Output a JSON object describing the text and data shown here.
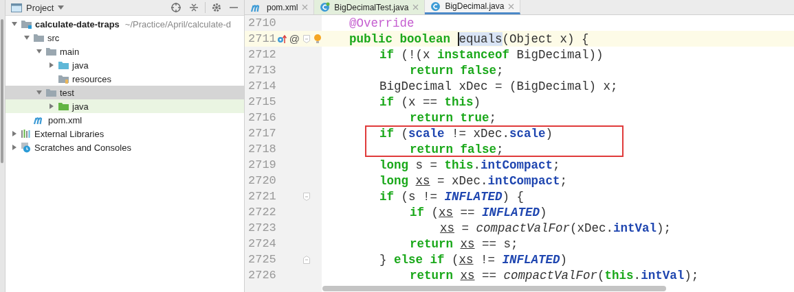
{
  "project_panel": {
    "title": "Project",
    "tree": [
      {
        "label": "calculate-date-traps",
        "path": "~/Practice/April/calculate-d",
        "kind": "module",
        "expanded": true,
        "selected": false,
        "highlighted": false,
        "children": [
          {
            "label": "src",
            "kind": "folder",
            "expanded": true,
            "selected": false,
            "highlighted": false,
            "children": [
              {
                "label": "main",
                "kind": "folder",
                "expanded": true,
                "selected": false,
                "highlighted": false,
                "children": [
                  {
                    "label": "java",
                    "kind": "source",
                    "expanded": false,
                    "selected": false,
                    "highlighted": false
                  },
                  {
                    "label": "resources",
                    "kind": "resources",
                    "selected": false,
                    "highlighted": false
                  }
                ]
              },
              {
                "label": "test",
                "kind": "folder",
                "expanded": true,
                "selected": true,
                "highlighted": false,
                "children": [
                  {
                    "label": "java",
                    "kind": "test-source",
                    "expanded": false,
                    "selected": false,
                    "highlighted": true
                  }
                ]
              }
            ]
          },
          {
            "label": "pom.xml",
            "kind": "maven",
            "selected": false,
            "highlighted": false
          }
        ]
      },
      {
        "label": "External Libraries",
        "kind": "libraries",
        "expanded": false,
        "selected": false,
        "highlighted": false
      },
      {
        "label": "Scratches and Consoles",
        "kind": "scratches",
        "expanded": false,
        "selected": false,
        "highlighted": false
      }
    ]
  },
  "tabs": [
    {
      "label": "pom.xml",
      "kind": "maven",
      "selected": false
    },
    {
      "label": "BigDecimalTest.java",
      "kind": "test-class",
      "selected": false
    },
    {
      "label": "BigDecimal.java",
      "kind": "class",
      "selected": true
    }
  ],
  "editor": {
    "lines": [
      {
        "number": "2710",
        "current": false,
        "boxed": false,
        "tokens": [
          {
            "text": "@Override",
            "kind": "ann"
          }
        ]
      },
      {
        "number": "2711",
        "current": true,
        "boxed": false,
        "override_marker": true,
        "annotation_marker": "@",
        "fold_start": true,
        "intention": true,
        "tokens": [
          {
            "text": "public boolean ",
            "kind": "kw"
          },
          {
            "text": "equals",
            "kind": "sel"
          },
          {
            "text": "(Object x) {",
            "kind": "plain"
          }
        ],
        "children": [
          {
            "number": "2712",
            "current": false,
            "boxed": false,
            "tokens": [
              {
                "text": "if ",
                "kind": "kw"
              },
              {
                "text": "(!(x ",
                "kind": "plain"
              },
              {
                "text": "instanceof",
                "kind": "kw"
              },
              {
                "text": " BigDecimal))",
                "kind": "plain"
              }
            ],
            "children": [
              {
                "number": "2713",
                "current": false,
                "boxed": false,
                "tokens": [
                  {
                    "text": "return false",
                    "kind": "kw"
                  },
                  {
                    "text": ";",
                    "kind": "plain"
                  }
                ]
              }
            ]
          },
          {
            "number": "2714",
            "current": false,
            "boxed": false,
            "tokens": [
              {
                "text": "BigDecimal xDec = (BigDecimal) x;",
                "kind": "plain"
              }
            ]
          },
          {
            "number": "2715",
            "current": false,
            "boxed": false,
            "tokens": [
              {
                "text": "if ",
                "kind": "kw"
              },
              {
                "text": "(x == ",
                "kind": "plain"
              },
              {
                "text": "this",
                "kind": "kw"
              },
              {
                "text": ")",
                "kind": "plain"
              }
            ],
            "children": [
              {
                "number": "2716",
                "current": false,
                "boxed": false,
                "tokens": [
                  {
                    "text": "return true",
                    "kind": "kw"
                  },
                  {
                    "text": ";",
                    "kind": "plain"
                  }
                ]
              }
            ]
          },
          {
            "number": "2717",
            "current": false,
            "boxed": true,
            "tokens": [
              {
                "text": "if ",
                "kind": "kw"
              },
              {
                "text": "(",
                "kind": "plain"
              },
              {
                "text": "scale",
                "kind": "field"
              },
              {
                "text": " != xDec.",
                "kind": "plain"
              },
              {
                "text": "scale",
                "kind": "field"
              },
              {
                "text": ")",
                "kind": "plain"
              }
            ],
            "children": [
              {
                "number": "2718",
                "current": false,
                "boxed": true,
                "tokens": [
                  {
                    "text": "return false",
                    "kind": "kw"
                  },
                  {
                    "text": ";",
                    "kind": "plain"
                  }
                ]
              }
            ]
          },
          {
            "number": "2719",
            "current": false,
            "boxed": false,
            "tokens": [
              {
                "text": "long ",
                "kind": "kw"
              },
              {
                "text": "s = ",
                "kind": "plain"
              },
              {
                "text": "this",
                "kind": "kw"
              },
              {
                "text": ".",
                "kind": "plain"
              },
              {
                "text": "intCompact",
                "kind": "field"
              },
              {
                "text": ";",
                "kind": "plain"
              }
            ]
          },
          {
            "number": "2720",
            "current": false,
            "boxed": false,
            "tokens": [
              {
                "text": "long ",
                "kind": "kw"
              },
              {
                "text": "xs",
                "kind": "var"
              },
              {
                "text": " = xDec.",
                "kind": "plain"
              },
              {
                "text": "intCompact",
                "kind": "field"
              },
              {
                "text": ";",
                "kind": "plain"
              }
            ]
          },
          {
            "number": "2721",
            "current": false,
            "boxed": false,
            "fold_start": true,
            "tokens": [
              {
                "text": "if ",
                "kind": "kw"
              },
              {
                "text": "(s != ",
                "kind": "plain"
              },
              {
                "text": "INFLATED",
                "kind": "const"
              },
              {
                "text": ") {",
                "kind": "plain"
              }
            ],
            "children": [
              {
                "number": "2722",
                "current": false,
                "boxed": false,
                "tokens": [
                  {
                    "text": "if ",
                    "kind": "kw"
                  },
                  {
                    "text": "(",
                    "kind": "plain"
                  },
                  {
                    "text": "xs",
                    "kind": "var"
                  },
                  {
                    "text": " == ",
                    "kind": "plain"
                  },
                  {
                    "text": "INFLATED",
                    "kind": "const"
                  },
                  {
                    "text": ")",
                    "kind": "plain"
                  }
                ],
                "children": [
                  {
                    "number": "2723",
                    "current": false,
                    "boxed": false,
                    "tokens": [
                      {
                        "text": "xs",
                        "kind": "var"
                      },
                      {
                        "text": " = ",
                        "kind": "plain"
                      },
                      {
                        "text": "compactValFor",
                        "kind": "call"
                      },
                      {
                        "text": "(xDec.",
                        "kind": "plain"
                      },
                      {
                        "text": "intVal",
                        "kind": "field"
                      },
                      {
                        "text": ");",
                        "kind": "plain"
                      }
                    ]
                  }
                ]
              },
              {
                "number": "2724",
                "current": false,
                "boxed": false,
                "tokens": [
                  {
                    "text": "return ",
                    "kind": "kw"
                  },
                  {
                    "text": "xs",
                    "kind": "var"
                  },
                  {
                    "text": " == s;",
                    "kind": "plain"
                  }
                ]
              }
            ]
          },
          {
            "number": "2725",
            "current": false,
            "boxed": false,
            "fold_end": true,
            "tokens": [
              {
                "text": "} ",
                "kind": "plain"
              },
              {
                "text": "else if ",
                "kind": "kw"
              },
              {
                "text": "(",
                "kind": "plain"
              },
              {
                "text": "xs",
                "kind": "var"
              },
              {
                "text": " != ",
                "kind": "plain"
              },
              {
                "text": "INFLATED",
                "kind": "const"
              },
              {
                "text": ")",
                "kind": "plain"
              }
            ],
            "children": [
              {
                "number": "2726",
                "current": false,
                "boxed": false,
                "tokens": [
                  {
                    "text": "return ",
                    "kind": "kw"
                  },
                  {
                    "text": "xs",
                    "kind": "var"
                  },
                  {
                    "text": " == ",
                    "kind": "plain"
                  },
                  {
                    "text": "compactValFor",
                    "kind": "call"
                  },
                  {
                    "text": "(",
                    "kind": "plain"
                  },
                  {
                    "text": "this",
                    "kind": "kw"
                  },
                  {
                    "text": ".",
                    "kind": "plain"
                  },
                  {
                    "text": "intVal",
                    "kind": "field"
                  },
                  {
                    "text": ");",
                    "kind": "plain"
                  }
                ]
              }
            ]
          }
        ]
      }
    ]
  }
}
